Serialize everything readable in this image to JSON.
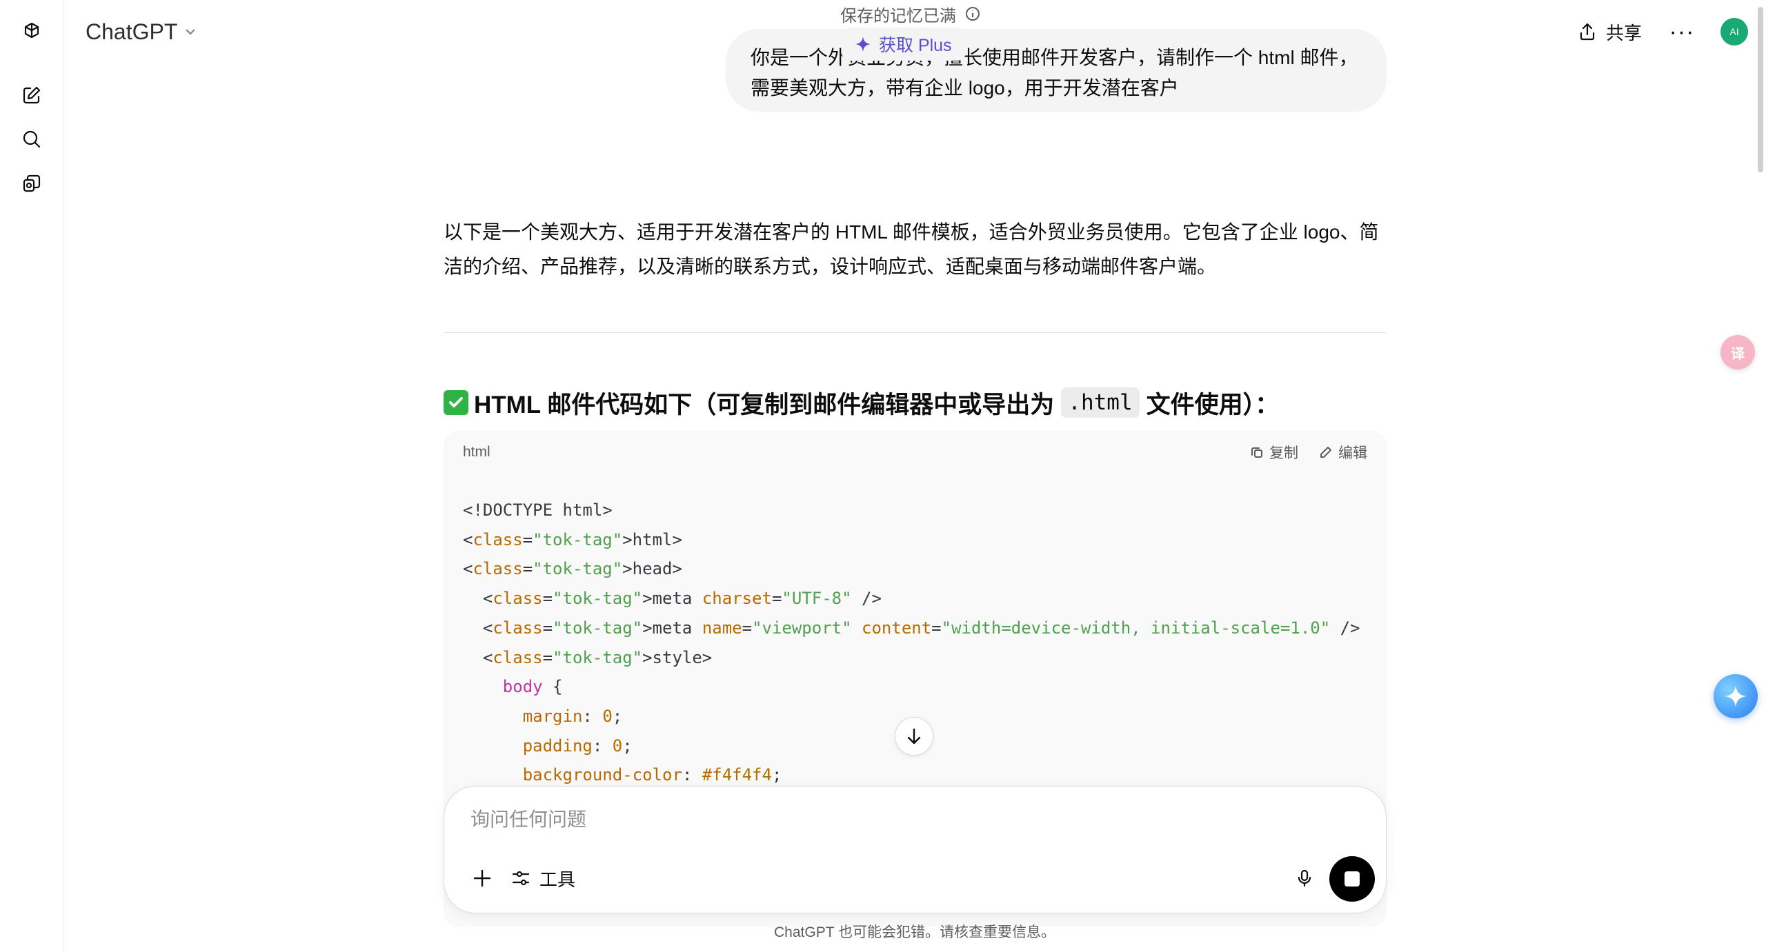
{
  "header": {
    "model_name": "ChatGPT",
    "memory_notice": "保存的记忆已满",
    "upgrade_label": "获取 Plus",
    "share_label": "共享",
    "more_label": "···",
    "avatar_initials": "AI"
  },
  "sidebar": {
    "icons": [
      "openai-logo-icon",
      "new-chat-icon",
      "search-icon",
      "library-icon"
    ]
  },
  "user_message": "你是一个外贸业务员，擅长使用邮件开发客户，请制作一个 html 邮件，需要美观大方，带有企业 logo，用于开发潜在客户",
  "assistant": {
    "intro": "以下是一个美观大方、适用于开发潜在客户的 HTML 邮件模板，适合外贸业务员使用。它包含了企业 logo、简洁的介绍、产品推荐，以及清晰的联系方式，设计响应式、适配桌面与移动端邮件客户端。",
    "heading_before": "HTML 邮件代码如下（可复制到邮件编辑器中或导出为",
    "heading_code": ".html",
    "heading_after": "文件使用）："
  },
  "code_block": {
    "language": "html",
    "copy_label": "复制",
    "edit_label": "编辑",
    "lines": [
      "<!DOCTYPE html>",
      "<html>",
      "<head>",
      "  <meta charset=\"UTF-8\" />",
      "  <meta name=\"viewport\" content=\"width=device-width, initial-scale=1.0\" />",
      "  <style>",
      "    body {",
      "      margin: 0;",
      "      padding: 0;",
      "      background-color: #f4f4f4;"
    ]
  },
  "composer": {
    "placeholder": "询问任何问题",
    "tools_label": "工具"
  },
  "footer": {
    "disclaimer": "ChatGPT 也可能会犯错。请核查重要信息。"
  },
  "colors": {
    "accent_plus": "#5a4fd1",
    "avatar_bg": "#19a974",
    "check_green": "#2fb344"
  }
}
